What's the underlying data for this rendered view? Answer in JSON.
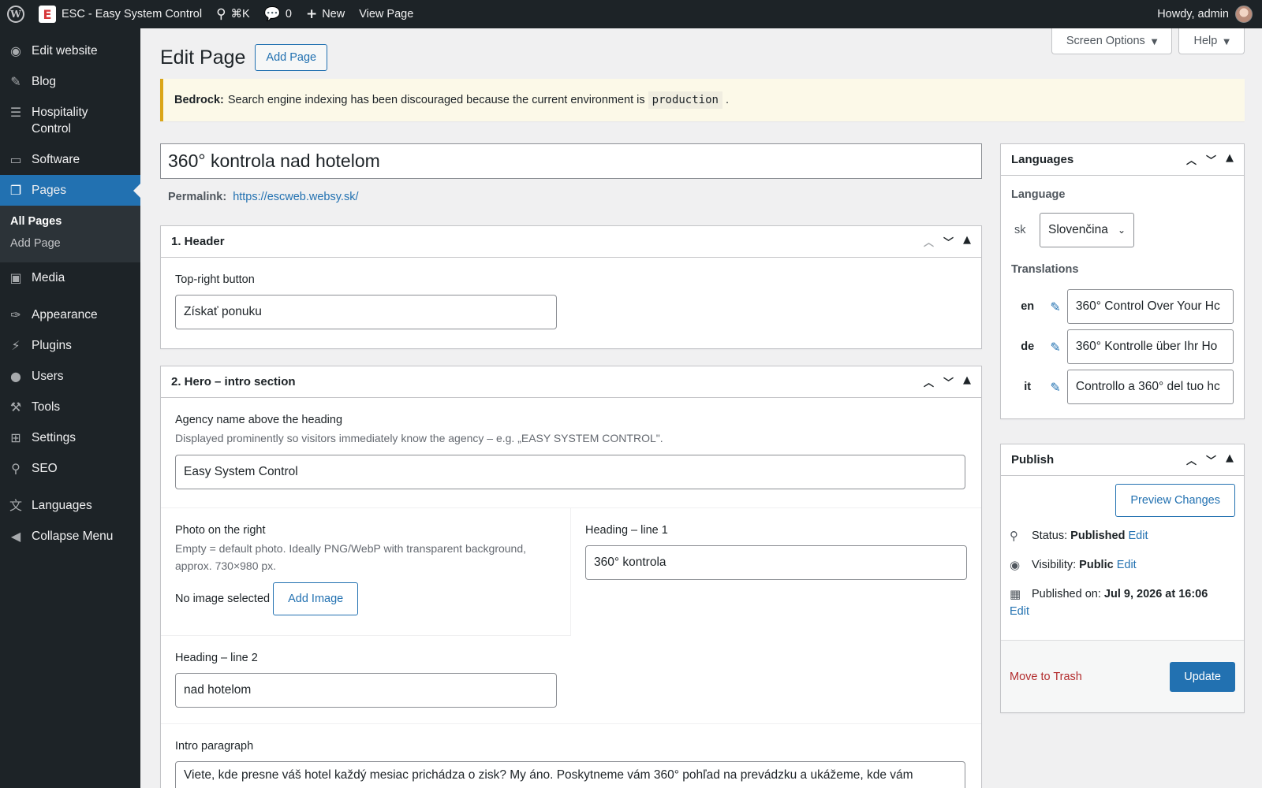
{
  "adminbar": {
    "site_name": "ESC - Easy System Control",
    "search_shortcut": "⌘K",
    "comments_count": "0",
    "new_label": "New",
    "view_page_label": "View Page",
    "howdy": "Howdy, admin"
  },
  "sidebar": {
    "items": [
      {
        "label": "Edit website",
        "icon": "eye-icon"
      },
      {
        "label": "Blog",
        "icon": "pin-icon"
      },
      {
        "label": "Hospitality Control",
        "icon": "list-icon"
      },
      {
        "label": "Software",
        "icon": "monitor-icon"
      },
      {
        "label": "Pages",
        "icon": "pages-icon"
      },
      {
        "label": "Media",
        "icon": "media-icon"
      },
      {
        "label": "Appearance",
        "icon": "brush-icon"
      },
      {
        "label": "Plugins",
        "icon": "plugin-icon"
      },
      {
        "label": "Users",
        "icon": "user-icon"
      },
      {
        "label": "Tools",
        "icon": "wrench-icon"
      },
      {
        "label": "Settings",
        "icon": "settings-icon"
      },
      {
        "label": "SEO",
        "icon": "search-icon"
      },
      {
        "label": "Languages",
        "icon": "translate-icon"
      },
      {
        "label": "Collapse Menu",
        "icon": "collapse-icon"
      }
    ],
    "submenu": [
      "All Pages",
      "Add Page"
    ]
  },
  "header": {
    "screen_options": "Screen Options",
    "help": "Help",
    "title": "Edit Page",
    "add_page": "Add Page"
  },
  "notice": {
    "strong": "Bedrock:",
    "text": "Search engine indexing has been discouraged because the current environment is",
    "code": "production",
    "end": "."
  },
  "post": {
    "title": "360° kontrola nad hotelom",
    "permalink_label": "Permalink:",
    "permalink_url": "https://escweb.websy.sk/"
  },
  "header_box": {
    "title": "1. Header",
    "top_right_label": "Top-right button",
    "top_right_value": "Získať ponuku"
  },
  "hero_box": {
    "title": "2. Hero – intro section",
    "agency_label": "Agency name above the heading",
    "agency_desc": "Displayed prominently so visitors immediately know the agency – e.g. „EASY SYSTEM CONTROL\".",
    "agency_value": "Easy System Control",
    "photo_label": "Photo on the right",
    "photo_desc": "Empty = default photo. Ideally PNG/WebP with transparent background, approx. 730×980 px.",
    "no_image": "No image selected",
    "add_image": "Add Image",
    "heading1_label": "Heading – line 1",
    "heading1_value": "360° kontrola",
    "heading2_label": "Heading – line 2",
    "heading2_value": "nad hotelom",
    "intro_label": "Intro paragraph",
    "intro_value": "Viete, kde presne váš hotel každý mesiac prichádza o zisk? My áno. Poskytneme vám 360° pohľad na prevádzku a ukážeme, kde vám"
  },
  "languages_box": {
    "title": "Languages",
    "language_label": "Language",
    "current_code": "sk",
    "current_language": "Slovenčina",
    "translations_label": "Translations",
    "translations": [
      {
        "code": "en",
        "value": "360° Control Over Your Hc"
      },
      {
        "code": "de",
        "value": "360° Kontrolle über Ihr Ho"
      },
      {
        "code": "it",
        "value": "Controllo a 360° del tuo hc"
      }
    ]
  },
  "publish_box": {
    "title": "Publish",
    "preview": "Preview Changes",
    "status_label": "Status:",
    "status_value": "Published",
    "visibility_label": "Visibility:",
    "visibility_value": "Public",
    "published_label": "Published on:",
    "published_value": "Jul 9, 2026 at 16:06",
    "edit": "Edit",
    "trash": "Move to Trash",
    "update": "Update"
  },
  "colors": {
    "admin_bar": "#1d2327",
    "accent": "#2271b1",
    "notice_border": "#dba617",
    "trash": "#b32d2e"
  }
}
